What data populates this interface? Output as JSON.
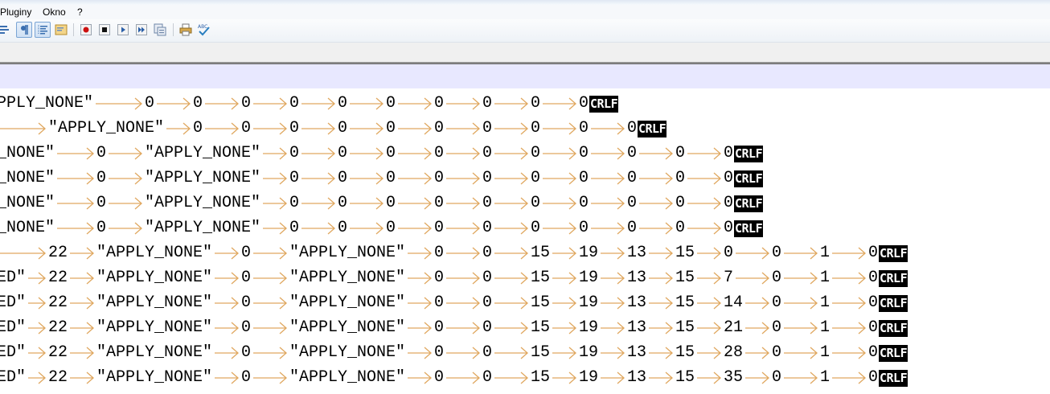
{
  "menu": {
    "items": [
      {
        "label": "Pluginy"
      },
      {
        "label": "Okno"
      },
      {
        "label": "?"
      }
    ]
  },
  "toolbar": {
    "buttons": [
      {
        "icon": "wrap-icon"
      },
      {
        "icon": "show-all-characters-icon",
        "active": true
      },
      {
        "icon": "indent-guide-icon",
        "active": true
      },
      {
        "icon": "doc-map-icon"
      },
      {
        "icon": "record-macro-icon"
      },
      {
        "icon": "stop-macro-icon"
      },
      {
        "icon": "play-macro-icon"
      },
      {
        "icon": "run-macro-multiple-icon"
      },
      {
        "icon": "save-macro-icon"
      },
      {
        "icon": "print-icon"
      },
      {
        "icon": "spell-check-icon"
      }
    ]
  },
  "editor": {
    "eol_label": "CRLF",
    "lines": [
      {
        "tokens": [
          "PPLY_NONE\"",
          "0",
          "0",
          "0",
          "0",
          "0",
          "0",
          "0",
          "0",
          "0",
          "0"
        ]
      },
      {
        "tokens": [
          "",
          "\"APPLY_NONE\"",
          "0",
          "0",
          "0",
          "0",
          "0",
          "0",
          "0",
          "0",
          "0",
          "0"
        ]
      },
      {
        "tokens": [
          "_NONE\"",
          "0",
          "\"APPLY_NONE\"",
          "0",
          "0",
          "0",
          "0",
          "0",
          "0",
          "0",
          "0",
          "0",
          "0"
        ]
      },
      {
        "tokens": [
          "_NONE\"",
          "0",
          "\"APPLY_NONE\"",
          "0",
          "0",
          "0",
          "0",
          "0",
          "0",
          "0",
          "0",
          "0",
          "0"
        ]
      },
      {
        "tokens": [
          "_NONE\"",
          "0",
          "\"APPLY_NONE\"",
          "0",
          "0",
          "0",
          "0",
          "0",
          "0",
          "0",
          "0",
          "0",
          "0"
        ]
      },
      {
        "tokens": [
          "_NONE\"",
          "0",
          "\"APPLY_NONE\"",
          "0",
          "0",
          "0",
          "0",
          "0",
          "0",
          "0",
          "0",
          "0",
          "0"
        ]
      },
      {
        "tokens": [
          "",
          "22",
          "\"APPLY_NONE\"",
          "0",
          "\"APPLY_NONE\"",
          "0",
          "0",
          "15",
          "19",
          "13",
          "15",
          "0",
          "0",
          "1",
          "0"
        ]
      },
      {
        "tokens": [
          "ED\"",
          "22",
          "\"APPLY_NONE\"",
          "0",
          "\"APPLY_NONE\"",
          "0",
          "0",
          "15",
          "19",
          "13",
          "15",
          "7",
          "0",
          "1",
          "0"
        ]
      },
      {
        "tokens": [
          "ED\"",
          "22",
          "\"APPLY_NONE\"",
          "0",
          "\"APPLY_NONE\"",
          "0",
          "0",
          "15",
          "19",
          "13",
          "15",
          "14",
          "0",
          "1",
          "0"
        ]
      },
      {
        "tokens": [
          "ED\"",
          "22",
          "\"APPLY_NONE\"",
          "0",
          "\"APPLY_NONE\"",
          "0",
          "0",
          "15",
          "19",
          "13",
          "15",
          "21",
          "0",
          "1",
          "0"
        ]
      },
      {
        "tokens": [
          "ED\"",
          "22",
          "\"APPLY_NONE\"",
          "0",
          "\"APPLY_NONE\"",
          "0",
          "0",
          "15",
          "19",
          "13",
          "15",
          "28",
          "0",
          "1",
          "0"
        ]
      },
      {
        "tokens": [
          "ED\"",
          "22",
          "\"APPLY_NONE\"",
          "0",
          "\"APPLY_NONE\"",
          "0",
          "0",
          "15",
          "19",
          "13",
          "15",
          "35",
          "0",
          "1",
          "0"
        ]
      }
    ]
  },
  "colors": {
    "tab_arrow": "#e0a860",
    "current_line": "#e8e8ff",
    "eol_background": "#000000",
    "eol_text": "#ffffff"
  }
}
